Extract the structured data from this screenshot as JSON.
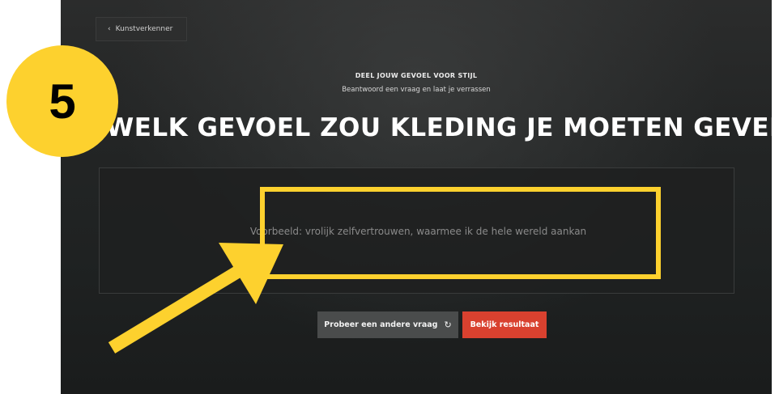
{
  "nav": {
    "back_label": "Kunstverkenner",
    "back_icon": "chevron-left-icon"
  },
  "header": {
    "eyebrow": "DEEL JOUW GEVOEL VOOR STIJL",
    "subtitle": "Beantwoord een vraag en laat je verrassen",
    "question": "WELK GEVOEL ZOU KLEDING JE MOETEN GEVEN?"
  },
  "answer": {
    "value": "",
    "placeholder": "Voorbeeld: vrolijk zelfvertrouwen, waarmee ik de hele wereld aankan"
  },
  "actions": {
    "other_question_label": "Probeer een andere vraag",
    "other_question_icon": "refresh-icon",
    "result_label": "Bekijk resultaat"
  },
  "overlay": {
    "step_number": "5",
    "highlight_color": "#fdd12e"
  },
  "colors": {
    "accent_red": "#d9412f",
    "background": "#232525",
    "annotation_yellow": "#fdd12e"
  }
}
